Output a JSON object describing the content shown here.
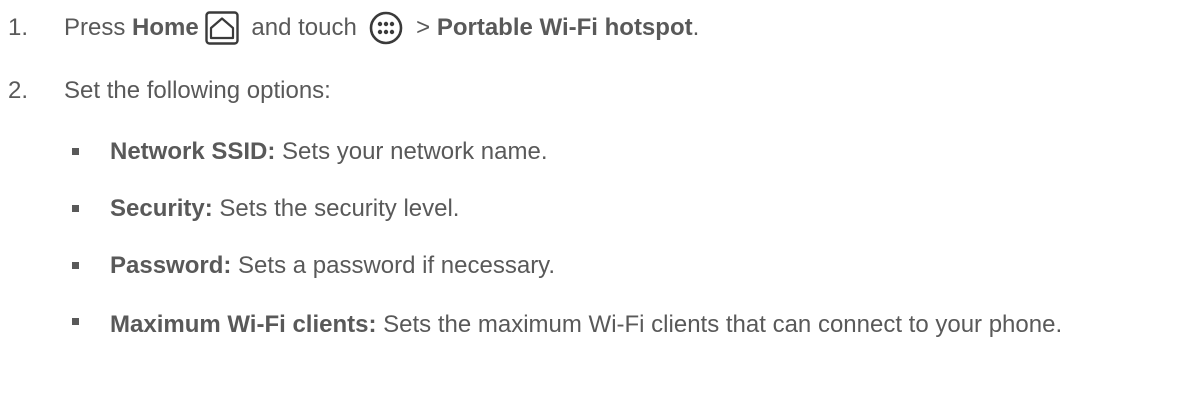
{
  "steps": [
    {
      "number": "1.",
      "press": "Press ",
      "home": "Home",
      "home_icon": "home-button-icon",
      "and_touch": " and touch ",
      "apps_icon": "apps-launcher-icon",
      "arrow": " > ",
      "target": "Portable Wi-Fi hotspot",
      "period": "."
    },
    {
      "number": "2.",
      "text": "Set the following options:"
    }
  ],
  "options": [
    {
      "label": "Network SSID:",
      "description": " Sets your network name."
    },
    {
      "label": "Security:",
      "description": " Sets the security level."
    },
    {
      "label": "Password:",
      "description": " Sets a password if necessary."
    },
    {
      "label": "Maximum Wi-Fi clients:",
      "description": " Sets the maximum Wi-Fi clients that can connect to your phone."
    }
  ]
}
